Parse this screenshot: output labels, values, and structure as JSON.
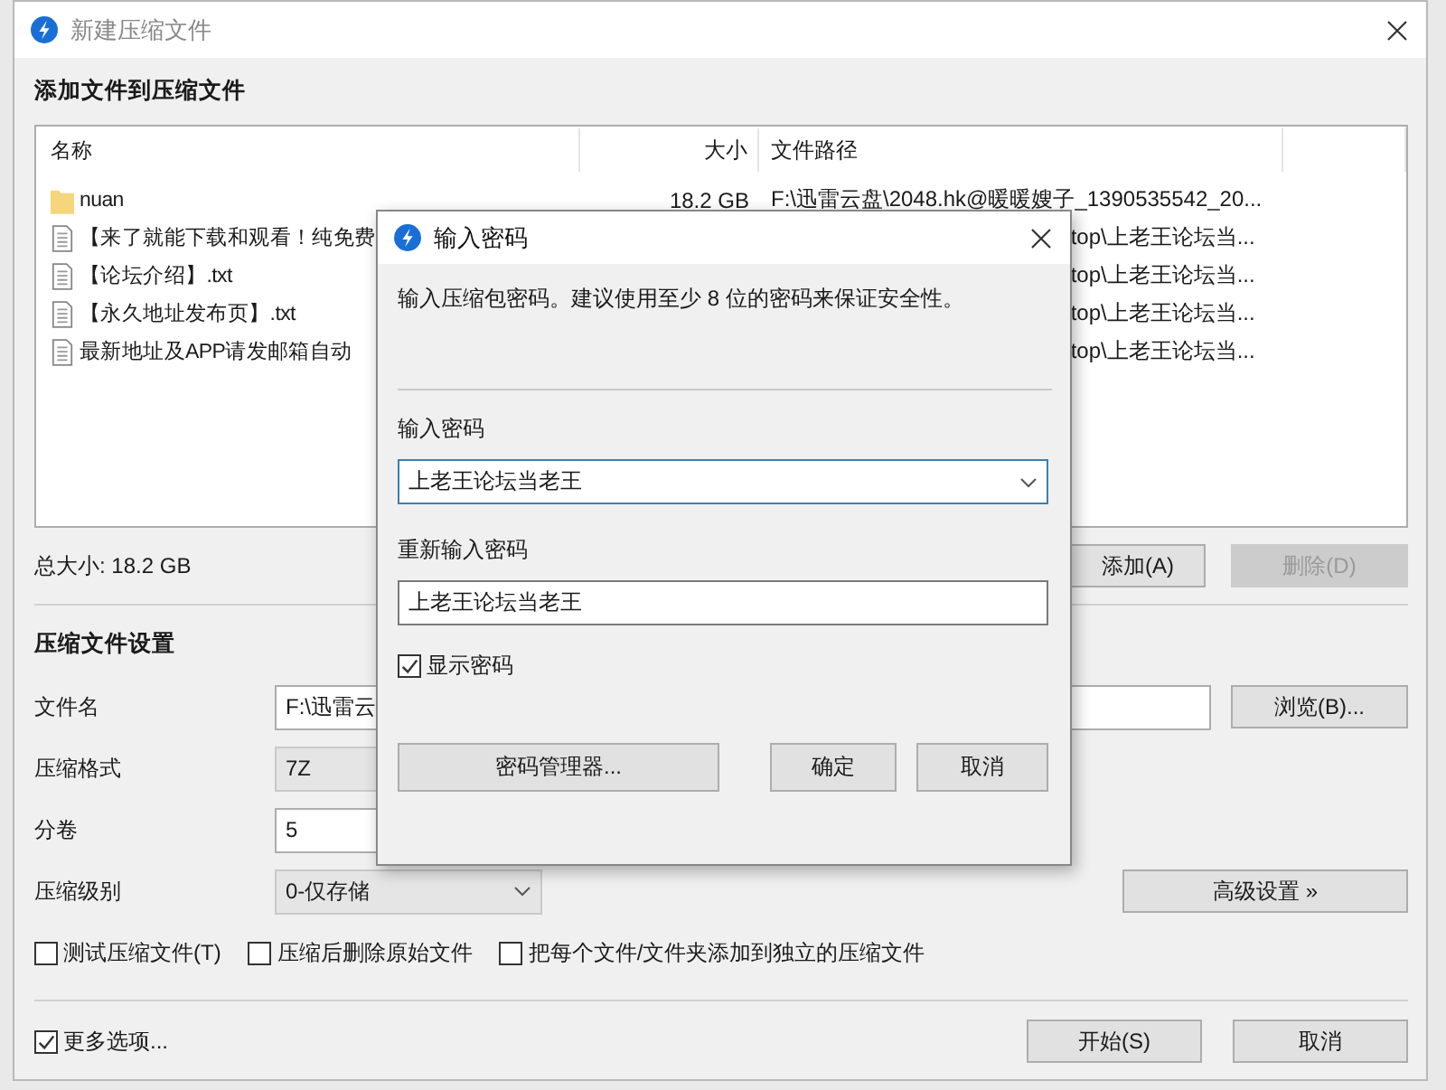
{
  "window": {
    "title": "新建压缩文件"
  },
  "files": {
    "heading": "添加文件到压缩文件",
    "columns": [
      "名称",
      "大小",
      "文件路径"
    ],
    "rows": [
      {
        "kind": "folder",
        "name": "nuan",
        "size": "18.2 GB",
        "path": "F:\\迅雷云盘\\2048.hk@暖暖嫂子_1390535542_20..."
      },
      {
        "kind": "file",
        "name": "【来了就能下载和观看！纯免费",
        "path": "top\\上老王论坛当..."
      },
      {
        "kind": "file",
        "name": "【论坛介绍】.txt",
        "path": "top\\上老王论坛当..."
      },
      {
        "kind": "file",
        "name": "【永久地址发布页】.txt",
        "path": "top\\上老王论坛当..."
      },
      {
        "kind": "file",
        "name": "最新地址及APP请发邮箱自动",
        "path": "top\\上老王论坛当..."
      }
    ],
    "total": "总大小: 18.2 GB",
    "buttons": [
      {
        "label": "添加(A)",
        "disabled": false
      },
      {
        "label": "删除(D)",
        "disabled": true
      }
    ]
  },
  "settings": {
    "heading": "压缩文件设置",
    "fields": [
      {
        "kind": "text",
        "label": "文件名",
        "value": "F:\\迅雷云"
      },
      {
        "kind": "select",
        "label": "压缩格式",
        "value": "7Z"
      },
      {
        "kind": "text",
        "label": "分卷",
        "value": "5"
      },
      {
        "kind": "dropdown",
        "label": "压缩级别",
        "value": "0-仅存储"
      }
    ],
    "browse_button": "浏览(B)...",
    "advanced_button": "高级设置 »",
    "options": [
      {
        "label": "测试压缩文件(T)",
        "checked": false
      },
      {
        "label": "压缩后删除原始文件",
        "checked": false
      },
      {
        "label": "把每个文件/文件夹添加到独立的压缩文件",
        "checked": false
      }
    ]
  },
  "footer": {
    "more_options": {
      "label": "更多选项...",
      "checked": true
    },
    "buttons": [
      "开始(S)",
      "取消"
    ]
  },
  "dialog": {
    "title": "输入密码",
    "description": "输入压缩包密码。建议使用至少 8 位的密码来保证安全性。",
    "password_label": "输入密码",
    "password": "上老王论坛当老王",
    "confirm_label": "重新输入密码",
    "confirm": "上老王论坛当老王",
    "show_password": {
      "label": "显示密码",
      "checked": true
    },
    "manager_button": "密码管理器...",
    "buttons": [
      "确定",
      "取消"
    ]
  }
}
